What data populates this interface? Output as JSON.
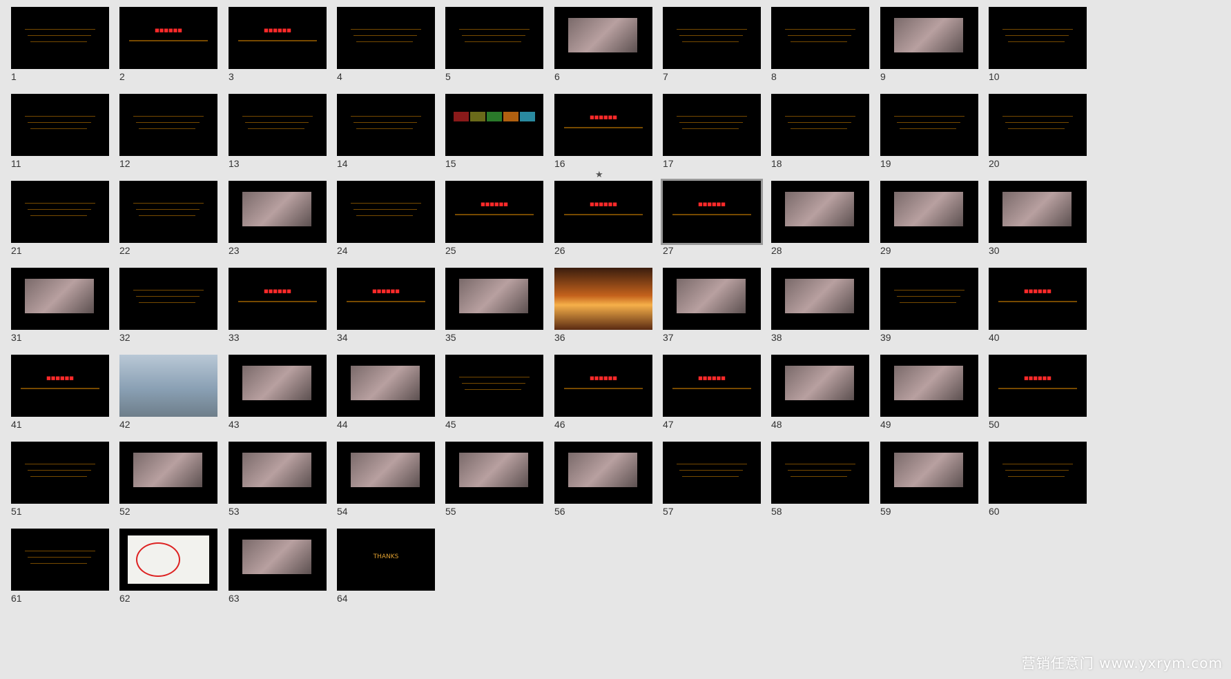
{
  "slides": [
    {
      "n": "1",
      "t": "dark"
    },
    {
      "n": "2",
      "t": "title"
    },
    {
      "n": "3",
      "t": "title"
    },
    {
      "n": "4",
      "t": "text"
    },
    {
      "n": "5",
      "t": "text"
    },
    {
      "n": "6",
      "t": "photo"
    },
    {
      "n": "7",
      "t": "text"
    },
    {
      "n": "8",
      "t": "text"
    },
    {
      "n": "9",
      "t": "photo"
    },
    {
      "n": "10",
      "t": "text"
    },
    {
      "n": "11",
      "t": "text"
    },
    {
      "n": "12",
      "t": "text"
    },
    {
      "n": "13",
      "t": "text"
    },
    {
      "n": "14",
      "t": "text"
    },
    {
      "n": "15",
      "t": "chart"
    },
    {
      "n": "16",
      "t": "title"
    },
    {
      "n": "17",
      "t": "text"
    },
    {
      "n": "18",
      "t": "text"
    },
    {
      "n": "19",
      "t": "text"
    },
    {
      "n": "20",
      "t": "text"
    },
    {
      "n": "21",
      "t": "text"
    },
    {
      "n": "22",
      "t": "text"
    },
    {
      "n": "23",
      "t": "photo"
    },
    {
      "n": "24",
      "t": "text"
    },
    {
      "n": "25",
      "t": "title"
    },
    {
      "n": "26",
      "t": "title"
    },
    {
      "n": "27",
      "t": "title"
    },
    {
      "n": "28",
      "t": "photo"
    },
    {
      "n": "29",
      "t": "photo"
    },
    {
      "n": "30",
      "t": "photo"
    },
    {
      "n": "31",
      "t": "photo"
    },
    {
      "n": "32",
      "t": "text"
    },
    {
      "n": "33",
      "t": "title"
    },
    {
      "n": "34",
      "t": "title"
    },
    {
      "n": "35",
      "t": "photo"
    },
    {
      "n": "36",
      "t": "sunset"
    },
    {
      "n": "37",
      "t": "photo"
    },
    {
      "n": "38",
      "t": "photo"
    },
    {
      "n": "39",
      "t": "text"
    },
    {
      "n": "40",
      "t": "title"
    },
    {
      "n": "41",
      "t": "title"
    },
    {
      "n": "42",
      "t": "beach"
    },
    {
      "n": "43",
      "t": "photo"
    },
    {
      "n": "44",
      "t": "photo"
    },
    {
      "n": "45",
      "t": "text"
    },
    {
      "n": "46",
      "t": "title"
    },
    {
      "n": "47",
      "t": "title"
    },
    {
      "n": "48",
      "t": "photo"
    },
    {
      "n": "49",
      "t": "photo"
    },
    {
      "n": "50",
      "t": "title"
    },
    {
      "n": "51",
      "t": "text"
    },
    {
      "n": "52",
      "t": "photo"
    },
    {
      "n": "53",
      "t": "photo"
    },
    {
      "n": "54",
      "t": "photo"
    },
    {
      "n": "55",
      "t": "photo"
    },
    {
      "n": "56",
      "t": "photo"
    },
    {
      "n": "57",
      "t": "text"
    },
    {
      "n": "58",
      "t": "text"
    },
    {
      "n": "59",
      "t": "photo"
    },
    {
      "n": "60",
      "t": "text"
    },
    {
      "n": "61",
      "t": "text"
    },
    {
      "n": "62",
      "t": "map"
    },
    {
      "n": "63",
      "t": "photo"
    },
    {
      "n": "64",
      "t": "thanks"
    }
  ],
  "selected_slide": "27",
  "starred_slide": "15",
  "star_glyph": "★",
  "thanks_text": "THANKS",
  "watermark": "营销任意门 www.yxrym.com",
  "colors": {
    "background": "#e6e6e6",
    "slide": "#000000",
    "accent_red": "#ff2a2a",
    "accent_orange": "#e0a030"
  }
}
